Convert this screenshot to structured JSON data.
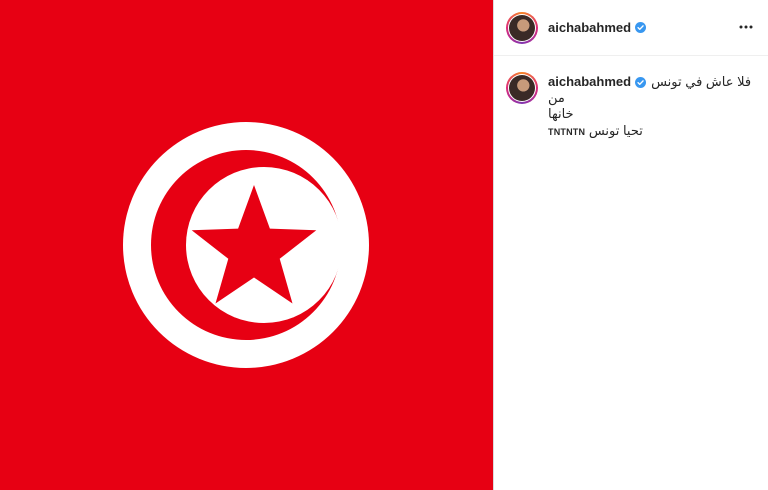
{
  "post": {
    "author": {
      "username": "aichabahmed",
      "verified": true
    },
    "menu_icon": "more-horizontal-icon",
    "caption": {
      "line1": "فلا عاش في تونس من",
      "line2": "خانها",
      "line3_text": "تحيا تونس",
      "line3_tag": "TNTNTN"
    },
    "media": {
      "subject": "flag-of-tunisia",
      "colors": {
        "field": "#e70013",
        "disc": "#ffffff",
        "emblem": "#e70013"
      }
    },
    "colors": {
      "verified_badge": "#3897f0",
      "text": "#262626",
      "divider": "#dbdbdb"
    }
  }
}
